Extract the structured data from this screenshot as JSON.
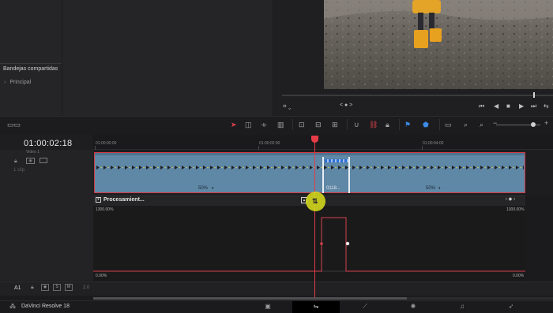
{
  "media": {
    "shared_bins_title": "Bandejas compartidas",
    "bin_item": "Principal"
  },
  "viewer": {
    "page_indicator": "< ● >",
    "transport": [
      "⏮",
      "◀",
      "■",
      "▶",
      "⏭",
      "⇆"
    ]
  },
  "timeline": {
    "timecode": "01:00:02:18",
    "ruler_labels": [
      "01:00:00:00",
      "01:00:02:00",
      "01:00:04:00"
    ],
    "track_title": "Video 1",
    "clip_count": "1 clip",
    "speed_segments": [
      "50%",
      "0118...",
      "50%"
    ],
    "curve_title": "Procesamient...",
    "curve_top_left": "1300.00%",
    "curve_top_right": "1300.00%",
    "curve_bottom_left": "0.00%",
    "curve_bottom_right": "0.00%",
    "audio_track": "A1",
    "audio_level": "2.0",
    "audio_buttons": [
      "S",
      "M"
    ]
  },
  "app": {
    "name": "DaVinci Resolve 18",
    "pages": [
      "Media",
      "Cut",
      "Edit",
      "Fusion",
      "Color",
      "Fairlight",
      "Deliver"
    ],
    "active_page": "Edit"
  },
  "colors": {
    "accent_red": "#e53c46",
    "clip_blue": "#5f87a6",
    "flag_blue": "#3c8be8",
    "click_highlight": "#d6dc1e"
  }
}
